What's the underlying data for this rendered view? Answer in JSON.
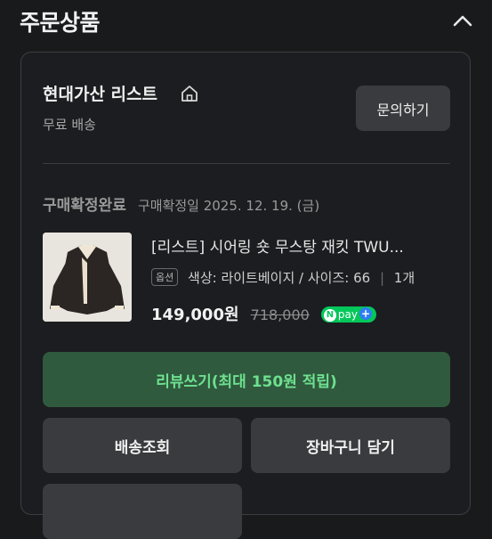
{
  "section": {
    "title": "주문상품"
  },
  "store": {
    "name": "현대가산 리스트",
    "shipping": "무료 배송",
    "inquiry_label": "문의하기"
  },
  "order": {
    "status": "구매확정완료",
    "confirmed_date": "구매확정일 2025. 12. 19. (금)"
  },
  "product": {
    "name": "[리스트] 시어링 숏 무스탕 재킷 TWU...",
    "option_badge": "옵션",
    "options": "색상: 라이트베이지 / 사이즈: 66",
    "quantity": "1개",
    "price": "149,000원",
    "original_price": "718,000",
    "pay_badge": "pay"
  },
  "actions": {
    "review_label": "리뷰쓰기(최대 150원 적립)",
    "track_label": "배송조회",
    "cart_label": "장바구니 담기"
  },
  "colors": {
    "background": "#191a1c",
    "review_bg": "#2f5a3e",
    "review_text": "#6ee08f",
    "npay_green": "#03c75a"
  }
}
